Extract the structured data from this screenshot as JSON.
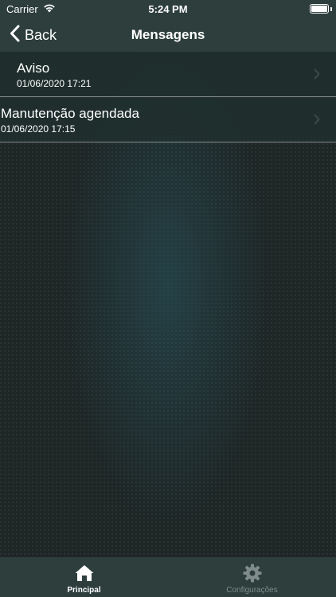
{
  "status_bar": {
    "carrier": "Carrier",
    "time": "5:24 PM",
    "icons": [
      "wifi-icon",
      "battery-icon"
    ]
  },
  "nav_bar": {
    "back_label": "Back",
    "title": "Mensagens"
  },
  "messages": [
    {
      "title": "Aviso",
      "date": "01/06/2020 17:21"
    },
    {
      "title": "Manutenção agendada",
      "date": "01/06/2020 17:15"
    }
  ],
  "tab_bar": {
    "tabs": [
      {
        "label": "Principal",
        "icon": "home-icon",
        "active": true
      },
      {
        "label": "Configurações",
        "icon": "gear-icon",
        "active": false
      }
    ]
  },
  "colors": {
    "bar_background": "#2d3e3c",
    "page_background": "#1e2626",
    "inactive_tab": "#7f8c8b"
  }
}
